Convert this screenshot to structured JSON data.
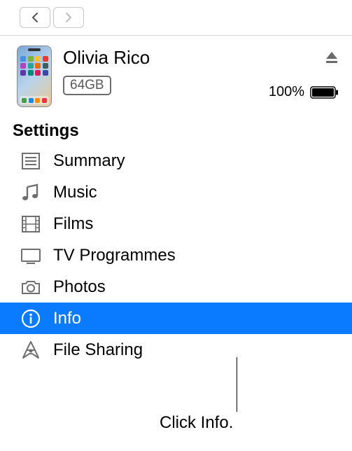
{
  "device": {
    "name": "Olivia Rico",
    "storage": "64GB",
    "battery": "100%"
  },
  "section_header": "Settings",
  "items": [
    {
      "label": "Summary",
      "icon": "summary-icon",
      "selected": false
    },
    {
      "label": "Music",
      "icon": "music-icon",
      "selected": false
    },
    {
      "label": "Films",
      "icon": "films-icon",
      "selected": false
    },
    {
      "label": "TV Programmes",
      "icon": "tv-icon",
      "selected": false
    },
    {
      "label": "Photos",
      "icon": "photos-icon",
      "selected": false
    },
    {
      "label": "Info",
      "icon": "info-icon",
      "selected": true
    },
    {
      "label": "File Sharing",
      "icon": "file-sharing-icon",
      "selected": false
    }
  ],
  "callout": "Click Info."
}
